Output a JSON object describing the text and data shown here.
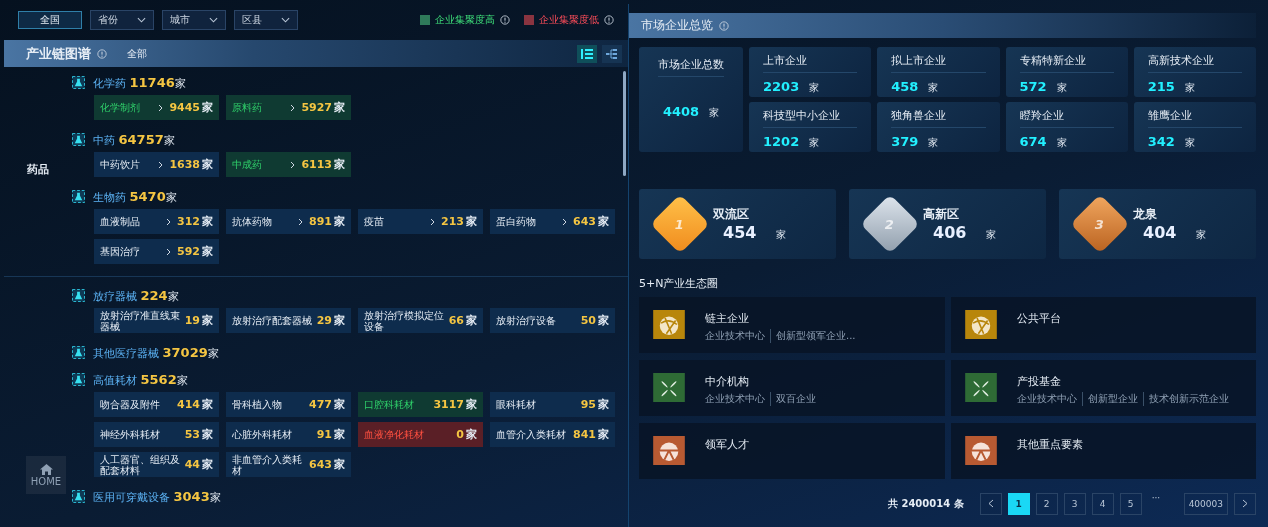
{
  "filters": {
    "scope_button": "全国",
    "selects": [
      "省份",
      "城市",
      "区县"
    ],
    "legend": [
      {
        "label": "企业集聚度高",
        "kind": "high"
      },
      {
        "label": "企业集聚度低",
        "kind": "low"
      }
    ]
  },
  "chain_map": {
    "title": "产业链图谱",
    "filter": "全部",
    "view_toggles": [
      {
        "kind": "list",
        "selected": true
      },
      {
        "kind": "tree",
        "selected": false
      }
    ],
    "sections": [
      {
        "label": "药品",
        "groups": [
          {
            "name": "化学药",
            "count": "11746",
            "unit": "家",
            "items": [
              {
                "name": "化学制剂",
                "count": "9445",
                "unit": "家",
                "kind": "high",
                "expandable": true
              },
              {
                "name": "原料药",
                "count": "5927",
                "unit": "家",
                "kind": "high",
                "expandable": true
              }
            ]
          },
          {
            "name": "中药",
            "count": "64757",
            "unit": "家",
            "items": [
              {
                "name": "中药饮片",
                "count": "1638",
                "unit": "家",
                "kind": "normal",
                "expandable": true
              },
              {
                "name": "中成药",
                "count": "6113",
                "unit": "家",
                "kind": "high",
                "expandable": true
              }
            ]
          },
          {
            "name": "生物药",
            "count": "5470",
            "unit": "家",
            "items": [
              {
                "name": "血液制品",
                "count": "312",
                "unit": "家",
                "kind": "normal",
                "expandable": true
              },
              {
                "name": "抗体药物",
                "count": "891",
                "unit": "家",
                "kind": "normal",
                "expandable": true
              },
              {
                "name": "疫苗",
                "count": "213",
                "unit": "家",
                "kind": "normal",
                "expandable": true
              },
              {
                "name": "蛋白药物",
                "count": "643",
                "unit": "家",
                "kind": "normal",
                "expandable": true
              },
              {
                "name": "基因治疗",
                "count": "592",
                "unit": "家",
                "kind": "normal",
                "expandable": true
              }
            ]
          }
        ]
      },
      {
        "groups": [
          {
            "name": "放疗器械",
            "count": "224",
            "unit": "家",
            "items": [
              {
                "name": "放射治疗准直线束器械",
                "count": "19",
                "unit": "家",
                "kind": "normal",
                "expandable": false
              },
              {
                "name": "放射治疗配套器械",
                "count": "29",
                "unit": "家",
                "kind": "normal",
                "expandable": false
              },
              {
                "name": "放射治疗模拟定位设备",
                "count": "66",
                "unit": "家",
                "kind": "normal",
                "expandable": false
              },
              {
                "name": "放射治疗设备",
                "count": "50",
                "unit": "家",
                "kind": "normal",
                "expandable": false
              }
            ]
          },
          {
            "name": "其他医疗器械",
            "count": "37029",
            "unit": "家"
          },
          {
            "name": "高值耗材",
            "count": "5562",
            "unit": "家",
            "items": [
              {
                "name": "吻合器及附件",
                "count": "414",
                "unit": "家",
                "kind": "normal",
                "expandable": false
              },
              {
                "name": "骨科植入物",
                "count": "477",
                "unit": "家",
                "kind": "normal",
                "expandable": false
              },
              {
                "name": "口腔科耗材",
                "count": "3117",
                "unit": "家",
                "kind": "high",
                "expandable": false
              },
              {
                "name": "眼科耗材",
                "count": "95",
                "unit": "家",
                "kind": "normal",
                "expandable": false
              },
              {
                "name": "神经外科耗材",
                "count": "53",
                "unit": "家",
                "kind": "normal",
                "expandable": false
              },
              {
                "name": "心脏外科耗材",
                "count": "91",
                "unit": "家",
                "kind": "normal",
                "expandable": false
              },
              {
                "name": "血液净化耗材",
                "count": "0",
                "unit": "家",
                "kind": "low",
                "expandable": false
              },
              {
                "name": "血管介入类耗材",
                "count": "841",
                "unit": "家",
                "kind": "normal",
                "expandable": false
              },
              {
                "name": "人工器官、组织及配套材料",
                "count": "44",
                "unit": "家",
                "kind": "normal",
                "expandable": false
              },
              {
                "name": "非血管介入类耗材",
                "count": "643",
                "unit": "家",
                "kind": "normal",
                "expandable": false
              }
            ]
          },
          {
            "name": "医用可穿戴设备",
            "count": "3043",
            "unit": "家"
          }
        ]
      }
    ]
  },
  "home_button": "HOME",
  "overview": {
    "title": "市场企业总览",
    "total": {
      "label": "市场企业总数",
      "value": "4408",
      "unit": "家"
    },
    "stats": [
      {
        "label": "上市企业",
        "value": "2203",
        "unit": "家"
      },
      {
        "label": "拟上市企业",
        "value": "458",
        "unit": "家"
      },
      {
        "label": "专精特新企业",
        "value": "572",
        "unit": "家"
      },
      {
        "label": "高新技术企业",
        "value": "215",
        "unit": "家"
      },
      {
        "label": "科技型中小企业",
        "value": "1202",
        "unit": "家"
      },
      {
        "label": "独角兽企业",
        "value": "379",
        "unit": "家"
      },
      {
        "label": "瞪羚企业",
        "value": "674",
        "unit": "家"
      },
      {
        "label": "雏鹰企业",
        "value": "342",
        "unit": "家"
      }
    ],
    "ranking": [
      {
        "rank": "1",
        "kind": "gold",
        "name": "双流区",
        "value": "454",
        "unit": "家"
      },
      {
        "rank": "2",
        "kind": "silver",
        "name": "高新区",
        "value": "406",
        "unit": "家"
      },
      {
        "rank": "3",
        "kind": "bronze",
        "name": "龙泉",
        "value": "404",
        "unit": "家"
      }
    ]
  },
  "ecosystem": {
    "title": "5+N产业生态圈",
    "cards": [
      {
        "name": "链主企业",
        "kind": "ball",
        "color": "#b8860b",
        "tags": [
          "企业技术中心",
          "创新型领军企业..."
        ]
      },
      {
        "name": "公共平台",
        "kind": "ball",
        "color": "#b8860b"
      },
      {
        "name": "中介机构",
        "kind": "flower",
        "color": "#2e6b35",
        "tags": [
          "企业技术中心",
          "双百企业"
        ]
      },
      {
        "name": "产投基金",
        "kind": "flower",
        "color": "#2e6b35",
        "tags": [
          "企业技术中心",
          "创新型企业",
          "技术创新示范企业"
        ]
      },
      {
        "name": "领军人才",
        "kind": "globe",
        "color": "#b85a32"
      },
      {
        "name": "其他重点要素",
        "kind": "globe",
        "color": "#b85a32"
      }
    ]
  },
  "pagination": {
    "total": "共 2400014 条",
    "pages": [
      {
        "label": "1",
        "selected": true
      },
      {
        "label": "2",
        "selected": false
      },
      {
        "label": "3",
        "selected": false
      },
      {
        "label": "4",
        "selected": false
      },
      {
        "label": "5",
        "selected": false
      },
      {
        "label": "···",
        "kind": "ellipsis"
      },
      {
        "label": "400003",
        "selected": false
      }
    ]
  }
}
